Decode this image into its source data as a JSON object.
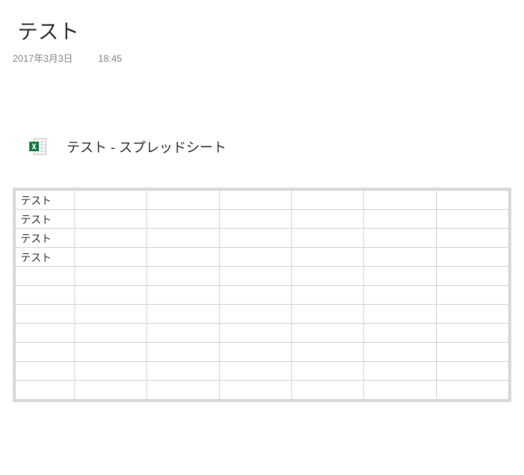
{
  "page": {
    "title": "テスト",
    "date": "2017年3月3日",
    "time": "18:45"
  },
  "attachment": {
    "label": "テスト - スプレッドシート"
  },
  "sheet": {
    "cols": 7,
    "rows": [
      [
        "テスト",
        "",
        "",
        "",
        "",
        "",
        ""
      ],
      [
        "テスト",
        "",
        "",
        "",
        "",
        "",
        ""
      ],
      [
        "テスト",
        "",
        "",
        "",
        "",
        "",
        ""
      ],
      [
        "テスト",
        "",
        "",
        "",
        "",
        "",
        ""
      ],
      [
        "",
        "",
        "",
        "",
        "",
        "",
        ""
      ],
      [
        "",
        "",
        "",
        "",
        "",
        "",
        ""
      ],
      [
        "",
        "",
        "",
        "",
        "",
        "",
        ""
      ],
      [
        "",
        "",
        "",
        "",
        "",
        "",
        ""
      ],
      [
        "",
        "",
        "",
        "",
        "",
        "",
        ""
      ],
      [
        "",
        "",
        "",
        "",
        "",
        "",
        ""
      ],
      [
        "",
        "",
        "",
        "",
        "",
        "",
        ""
      ]
    ]
  }
}
